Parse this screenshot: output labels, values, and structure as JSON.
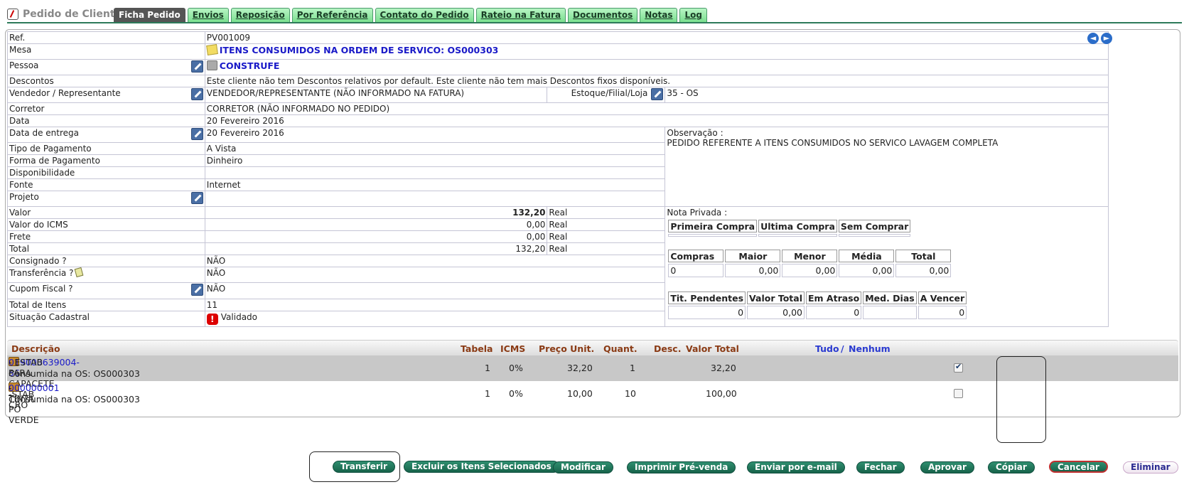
{
  "header": {
    "title": "Pedido de Cliente"
  },
  "tabs": [
    "Ficha Pedido",
    "Envios",
    "Reposição",
    "Por Referência",
    "Contato do Pedido",
    "Rateio na Fatura",
    "Documentos",
    "Notas",
    "Log"
  ],
  "nav": {
    "prev": "◄",
    "next": "►"
  },
  "form": {
    "ref_label": "Ref.",
    "ref_value": "PV001009",
    "mesa_label": "Mesa",
    "mesa_value": "ITENS CONSUMIDOS NA ORDEM DE SERVICO: OS000303",
    "pessoa_label": "Pessoa",
    "pessoa_value": "CONSTRUFE",
    "descontos_label": "Descontos",
    "descontos_value": "Este cliente não tem Descontos relativos por default. Este cliente não tem mais Descontos fixos disponíveis.",
    "vendedor_label": "Vendedor / Representante",
    "vendedor_value": "VENDEDOR/REPRESENTANTE (NÃO INFORMADO NA FATURA)",
    "estoque_label": "Estoque/Filial/Loja",
    "estoque_value": "35 - OS",
    "corretor_label": "Corretor",
    "corretor_value": "CORRETOR (NÃO INFORMADO NO PEDIDO)",
    "data_label": "Data",
    "data_value": "20 Fevereiro 2016",
    "entrega_label": "Data de entrega",
    "entrega_value": "20 Fevereiro 2016",
    "observacao_label": "Observação :",
    "observacao_value": "PEDIDO REFERENTE A ITENS CONSUMIDOS NO SERVICO LAVAGEM COMPLETA",
    "tipo_pag_label": "Tipo de Pagamento",
    "tipo_pag_value": "A Vista",
    "forma_pag_label": "Forma de Pagamento",
    "forma_pag_value": "Dinheiro",
    "disponibilidade_label": "Disponibilidade",
    "disponibilidade_value": "",
    "fonte_label": "Fonte",
    "fonte_value": "Internet",
    "projeto_label": "Projeto",
    "projeto_value": "",
    "valor_label": "Valor",
    "valor_value": "132,20",
    "valor_cur": "Real",
    "icms_label": "Valor do ICMS",
    "icms_value": "0,00",
    "icms_cur": "Real",
    "frete_label": "Frete",
    "frete_value": "0,00",
    "frete_cur": "Real",
    "total_label": "Total",
    "total_value": "132,20",
    "total_cur": "Real",
    "consignado_label": "Consignado ?",
    "consignado_value": "NÃO",
    "transferencia_label": "Transferência ?",
    "transferencia_value": "NÃO",
    "cupom_label": "Cupom Fiscal ?",
    "cupom_value": "NÃO",
    "total_itens_label": "Total de Itens",
    "total_itens_value": "11",
    "situacao_label": "Situação Cadastral",
    "situacao_value": "Validado",
    "nota_privada_label": "Nota Privada :"
  },
  "stats": {
    "purchase_headers": [
      "Primeira Compra",
      "Ultima Compra",
      "Sem Comprar"
    ],
    "compras_headers": [
      "Compras",
      "Maior",
      "Menor",
      "Média",
      "Total"
    ],
    "compras_values": [
      "0",
      "0,00",
      "0,00",
      "0,00",
      "0,00"
    ],
    "titulos_headers": [
      "Tit. Pendentes",
      "Valor Total",
      "Em Atraso",
      "Med. Dias",
      "A Vencer"
    ],
    "titulos_values": [
      "0",
      "0,00",
      "0",
      "",
      "0"
    ]
  },
  "items": {
    "headers": {
      "descricao": "Descrição",
      "tabela": "Tabela",
      "icms": "ICMS",
      "preco": "Preço Unit.",
      "quant": "Quant.",
      "desc": "Desc.",
      "valor_total": "Valor Total",
      "tudo": "Tudo",
      "sep": "/",
      "nenhum": "Nenhum"
    },
    "rows": [
      {
        "code": "019000639004-56",
        "name": " - ESTAB PARA CAPACETE -STAB CRO",
        "sub": "Consumida na OS: OS000303",
        "tabela": "1",
        "icms": "0%",
        "preco": "32,20",
        "quant": "1",
        "total": "32,20",
        "checked": true
      },
      {
        "code": "000000001",
        "name": " - TINTA PÓ VERDE",
        "sub": "Consumida na OS: OS000303",
        "tabela": "1",
        "icms": "0%",
        "preco": "10,00",
        "quant": "10",
        "total": "100,00",
        "checked": false
      }
    ]
  },
  "buttons": {
    "transferir": "Transferir",
    "excluir": "Excluir os Itens Selecionados",
    "modificar": "Modificar",
    "imprimir": "Imprimir Pré-venda",
    "email": "Enviar por e-mail",
    "fechar": "Fechar",
    "aprovar": "Aprovar",
    "copiar": "Cópiar",
    "cancelar": "Cancelar",
    "eliminar": "Eliminar"
  }
}
